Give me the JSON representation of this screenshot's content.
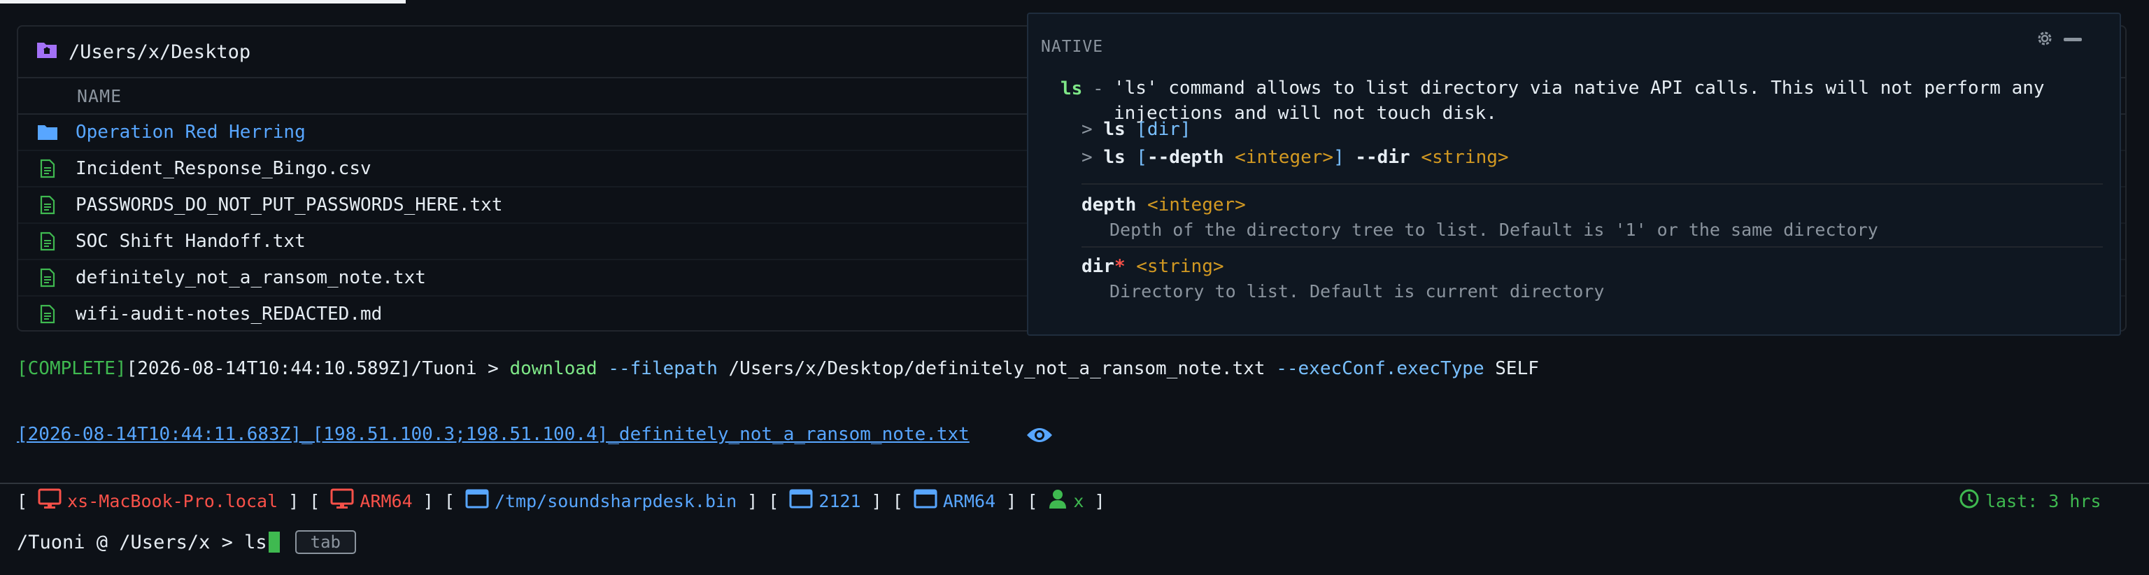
{
  "file_browser": {
    "path": "/Users/x/Desktop",
    "column_name": "NAME",
    "items": [
      {
        "name": "Operation Red Herring",
        "type": "folder"
      },
      {
        "name": "Incident_Response_Bingo.csv",
        "type": "file"
      },
      {
        "name": "PASSWORDS_DO_NOT_PUT_PASSWORDS_HERE.txt",
        "type": "file"
      },
      {
        "name": "SOC Shift Handoff.txt",
        "type": "file"
      },
      {
        "name": "definitely_not_a_ransom_note.txt",
        "type": "file"
      },
      {
        "name": "wifi-audit-notes_REDACTED.md",
        "type": "file"
      }
    ]
  },
  "help": {
    "badge": "NATIVE",
    "command": "ls",
    "dash": "-",
    "description_1": "'ls' command allows to list directory via native API calls. This will not perform any",
    "description_2": "injections and will not touch disk.",
    "usage_1": {
      "arrow": ">",
      "cmd": "ls",
      "arg": "[dir]"
    },
    "usage_2": {
      "arrow": ">",
      "cmd": "ls",
      "open": "[",
      "flag1": "--depth",
      "type1": "<integer>",
      "close": "]",
      "flag2": "--dir",
      "type2": "<string>"
    },
    "params": [
      {
        "name": "depth",
        "type": "<integer>",
        "required": "",
        "desc": "Depth of the directory tree to list. Default is '1' or the same directory"
      },
      {
        "name": "dir",
        "type": "<string>",
        "required": "*",
        "desc": "Directory to list. Default is current directory"
      }
    ]
  },
  "terminal": {
    "status": "[COMPLETE]",
    "timestamp": "[2026-08-14T10:44:10.589Z]",
    "prompt": "/Tuoni > ",
    "command": "download",
    "flag_filepath": "--filepath",
    "filepath": " /Users/x/Desktop/definitely_not_a_ransom_note.txt ",
    "flag_exec": "--execConf.execType",
    "exec_value": " SELF",
    "download_link": "[2026-08-14T10:44:11.683Z]_[198.51.100.3;198.51.100.4]_definitely_not_a_ransom_note.txt"
  },
  "status_bar": {
    "hostname": "xs-MacBook-Pro.local",
    "arch1": "ARM64",
    "binary": "/tmp/soundsharpdesk.bin",
    "pid": "2121",
    "arch2": "ARM64",
    "user": "x",
    "last_seen": "last: 3 hrs"
  },
  "prompt_line": {
    "prompt": "/Tuoni @ /Users/x > ",
    "input": "ls",
    "hint": "tab"
  },
  "colors": {
    "accent": "#58a6ff",
    "success": "#3fb950",
    "danger": "#f85149",
    "warning": "#d29922"
  }
}
